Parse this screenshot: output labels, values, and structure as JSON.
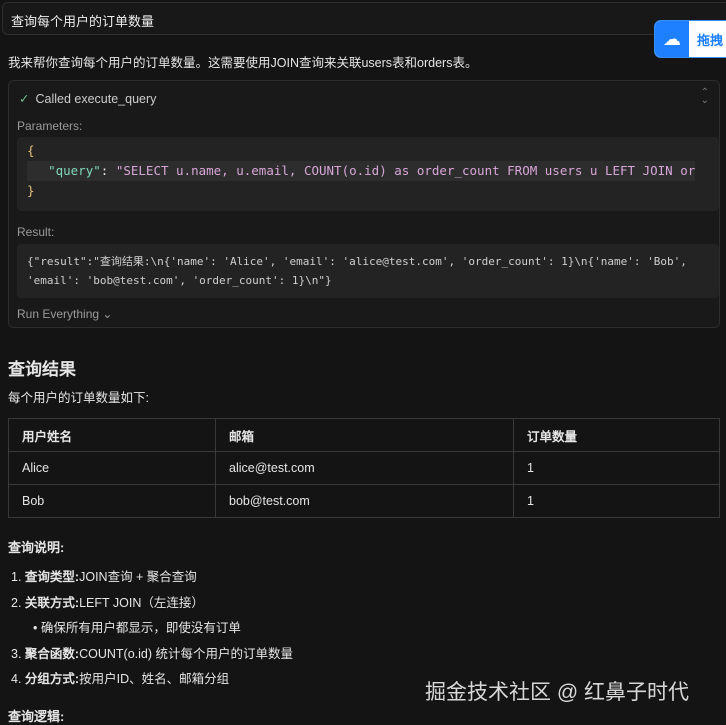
{
  "user_message": "查询每个用户的订单数量",
  "extension": {
    "icon": "baidu-netdisk-icon",
    "label": "拖拽"
  },
  "intro": "我来帮你查询每个用户的订单数量。这需要使用JOIN查询来关联users表和orders表。",
  "tool": {
    "status": "Called execute_query",
    "params_label": "Parameters:",
    "open_brace": "{",
    "key": "\"query\"",
    "colon": ": ",
    "value": "\"SELECT u.name, u.email, COUNT(o.id) as order_count FROM users u LEFT JOIN or",
    "close_brace": "}",
    "result_label": "Result:",
    "result": "{\"result\":\"查询结果:\\n{'name': 'Alice', 'email': 'alice@test.com', 'order_count': 1}\\n{'name': 'Bob', 'email': 'bob@test.com', 'order_count': 1}\\n\"}",
    "run_label": "Run Everything"
  },
  "results": {
    "title": "查询结果",
    "subtitle": "每个用户的订单数量如下:",
    "headers": [
      "用户姓名",
      "邮箱",
      "订单数量"
    ],
    "rows": [
      [
        "Alice",
        "alice@test.com",
        "1"
      ],
      [
        "Bob",
        "bob@test.com",
        "1"
      ]
    ]
  },
  "explanation": {
    "title": "查询说明:",
    "items": [
      {
        "n": "1.",
        "label": "查询类型:",
        "text": "JOIN查询 + 聚合查询"
      },
      {
        "n": "2.",
        "label": "关联方式:",
        "text": "LEFT JOIN（左连接）"
      },
      {
        "bullet": "确保所有用户都显示，即使没有订单"
      },
      {
        "n": "3.",
        "label": "聚合函数:",
        "text": "COUNT(o.id) 统计每个用户的订单数量"
      },
      {
        "n": "4.",
        "label": "分组方式:",
        "text": "按用户ID、姓名、邮箱分组"
      }
    ]
  },
  "logic_title": "查询逻辑:",
  "watermark": "掘金技术社区 @ 红鼻子时代"
}
